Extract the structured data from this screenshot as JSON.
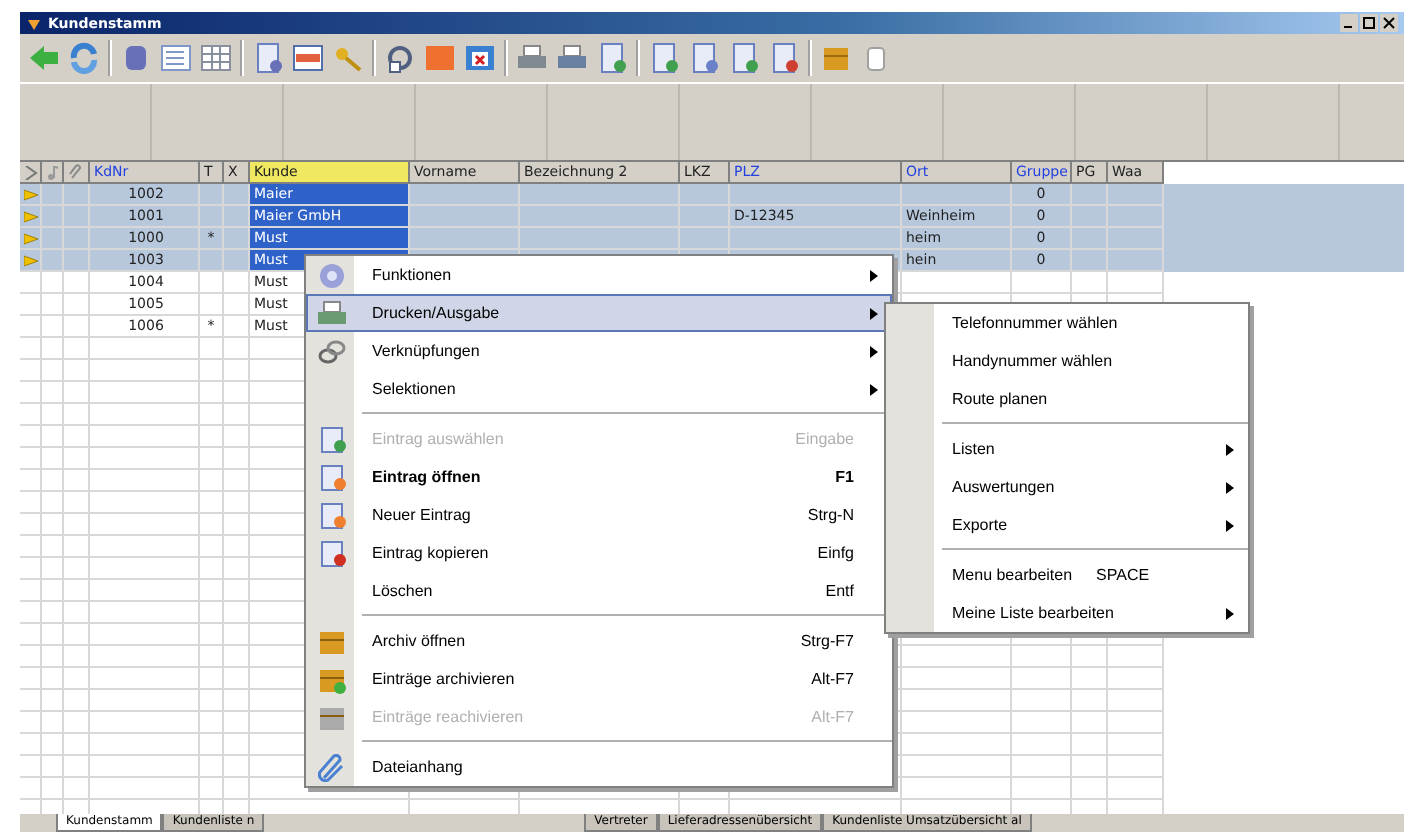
{
  "window": {
    "title": "Kundenstamm"
  },
  "table": {
    "columns": [
      {
        "label": "KdNr",
        "indexed": true,
        "selected": false
      },
      {
        "label": "T",
        "indexed": false,
        "selected": false
      },
      {
        "label": "X",
        "indexed": false,
        "selected": false
      },
      {
        "label": "Kunde",
        "indexed": false,
        "selected": true
      },
      {
        "label": "Vorname",
        "indexed": false,
        "selected": false
      },
      {
        "label": "Bezeichnung 2",
        "indexed": false,
        "selected": false
      },
      {
        "label": "LKZ",
        "indexed": false,
        "selected": false
      },
      {
        "label": "PLZ",
        "indexed": true,
        "selected": false
      },
      {
        "label": "Ort",
        "indexed": true,
        "selected": false
      },
      {
        "label": "Gruppe",
        "indexed": true,
        "selected": false
      },
      {
        "label": "PG",
        "indexed": false,
        "selected": false
      },
      {
        "label": "Waa",
        "indexed": false,
        "selected": false
      }
    ],
    "rows": [
      {
        "kdnr": "1002",
        "t": "",
        "kunde": "Maier",
        "plz": "",
        "ort": "",
        "gruppe": "0",
        "selected": true
      },
      {
        "kdnr": "1001",
        "t": "",
        "kunde": "Maier GmbH",
        "plz": "D-12345",
        "ort": "Weinheim",
        "gruppe": "0",
        "selected": true
      },
      {
        "kdnr": "1000",
        "t": "*",
        "kunde": "Must",
        "plz": "",
        "ort": "heim",
        "gruppe": "0",
        "selected": true
      },
      {
        "kdnr": "1003",
        "t": "",
        "kunde": "Must",
        "plz": "",
        "ort": "hein",
        "gruppe": "0",
        "selected": true
      },
      {
        "kdnr": "1004",
        "t": "",
        "kunde": "Must",
        "plz": "",
        "ort": "",
        "gruppe": "",
        "selected": false
      },
      {
        "kdnr": "1005",
        "t": "",
        "kunde": "Must",
        "plz": "",
        "ort": "",
        "gruppe": "",
        "selected": false
      },
      {
        "kdnr": "1006",
        "t": "*",
        "kunde": "Must",
        "plz": "",
        "ort": "",
        "gruppe": "",
        "selected": false
      }
    ]
  },
  "context_menu": {
    "items": [
      {
        "kind": "item",
        "label": "Funktionen",
        "submenu": true,
        "selected": false,
        "disabled": false,
        "default": false
      },
      {
        "kind": "item",
        "label": "Drucken/Ausgabe",
        "submenu": true,
        "selected": true,
        "disabled": false,
        "default": false
      },
      {
        "kind": "item",
        "label": "Verknüpfungen",
        "submenu": true,
        "selected": false,
        "disabled": false,
        "default": false
      },
      {
        "kind": "item",
        "label": "Selektionen",
        "submenu": true,
        "selected": false,
        "disabled": false,
        "default": false
      },
      {
        "kind": "separator"
      },
      {
        "kind": "item",
        "label": "Eintrag auswählen",
        "shortcut": "Eingabe",
        "submenu": false,
        "selected": false,
        "disabled": true,
        "default": false
      },
      {
        "kind": "item",
        "label": "Eintrag öffnen",
        "shortcut": "F1",
        "submenu": false,
        "selected": false,
        "disabled": false,
        "default": true
      },
      {
        "kind": "item",
        "label": "Neuer Eintrag",
        "shortcut": "Strg-N",
        "submenu": false,
        "selected": false,
        "disabled": false,
        "default": false
      },
      {
        "kind": "item",
        "label": "Eintrag kopieren",
        "shortcut": "Einfg",
        "submenu": false,
        "selected": false,
        "disabled": false,
        "default": false
      },
      {
        "kind": "item",
        "label": "Löschen",
        "shortcut": "Entf",
        "submenu": false,
        "selected": false,
        "disabled": false,
        "default": false
      },
      {
        "kind": "separator"
      },
      {
        "kind": "item",
        "label": "Archiv öffnen",
        "shortcut": "Strg-F7",
        "submenu": false,
        "selected": false,
        "disabled": false,
        "default": false
      },
      {
        "kind": "item",
        "label": "Einträge archivieren",
        "shortcut": "Alt-F7",
        "submenu": false,
        "selected": false,
        "disabled": false,
        "default": false
      },
      {
        "kind": "item",
        "label": "Einträge reachivieren",
        "shortcut": "Alt-F7",
        "submenu": false,
        "selected": false,
        "disabled": true,
        "default": false
      },
      {
        "kind": "separator"
      },
      {
        "kind": "item",
        "label": "Dateianhang",
        "submenu": false,
        "selected": false,
        "disabled": false,
        "default": false
      }
    ]
  },
  "submenu": {
    "items": [
      {
        "kind": "item",
        "label": "Telefonnummer wählen",
        "submenu": false
      },
      {
        "kind": "item",
        "label": "Handynummer wählen",
        "submenu": false
      },
      {
        "kind": "item",
        "label": "Route planen",
        "submenu": false
      },
      {
        "kind": "separator"
      },
      {
        "kind": "item",
        "label": "Listen",
        "submenu": true
      },
      {
        "kind": "item",
        "label": "Auswertungen",
        "submenu": true
      },
      {
        "kind": "item",
        "label": "Exporte",
        "submenu": true
      },
      {
        "kind": "separator"
      },
      {
        "kind": "item",
        "label": "Menu bearbeiten",
        "shortcut": "SPACE",
        "submenu": false
      },
      {
        "kind": "item",
        "label": "Meine Liste bearbeiten",
        "submenu": true
      }
    ]
  },
  "sheet_tabs": [
    {
      "label": "Kundenstamm",
      "selected": true,
      "covered_after": false
    },
    {
      "label": "Kundenliste n",
      "selected": false,
      "covered_after": true
    },
    {
      "label": "Vertreter",
      "selected": false,
      "covered_after": false
    },
    {
      "label": "Lieferadressenübersicht",
      "selected": false,
      "covered_after": false
    },
    {
      "label": "Kundenliste Umsatzübersicht al",
      "selected": false,
      "covered_after": false
    }
  ]
}
